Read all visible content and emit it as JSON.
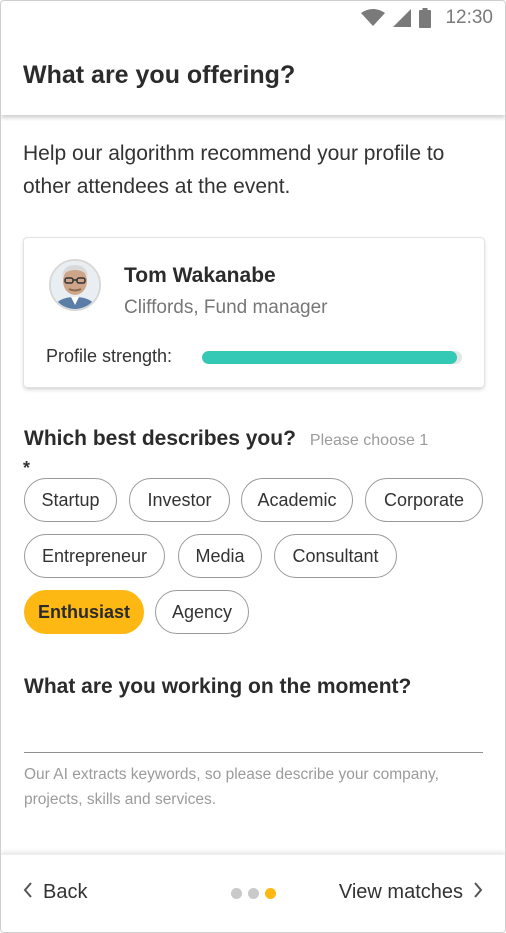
{
  "status_bar": {
    "time": "12:30",
    "icons": [
      "wifi-icon",
      "signal-icon",
      "battery-icon"
    ]
  },
  "header": {
    "title": "What are you offering?"
  },
  "intro": "Help our algorithm recommend your profile to other attendees at the event.",
  "profile": {
    "name": "Tom Wakanabe",
    "role": "Cliffords, Fund manager",
    "strength_label": "Profile strength:",
    "strength_fraction": 0.98
  },
  "question1": {
    "title": "Which best describes you?",
    "hint": "Please choose 1",
    "required_mark": "*",
    "options": [
      "Startup",
      "Investor",
      "Academic",
      "Corporate",
      "Entrepreneur",
      "Media",
      "Consultant",
      "Enthusiast",
      "Agency"
    ],
    "selected": "Enthusiast"
  },
  "question2": {
    "title": "What are you working on the moment?",
    "value": "",
    "help": "Our AI extracts keywords, so please describe your company, projects, skills and services."
  },
  "nav": {
    "back_label": "Back",
    "next_label": "View matches",
    "page_count": 3,
    "current_page": 3
  },
  "colors": {
    "accent": "#fdb813",
    "progress": "#33c9b5",
    "text": "#2b2b2b",
    "muted": "#9b9b9b"
  }
}
